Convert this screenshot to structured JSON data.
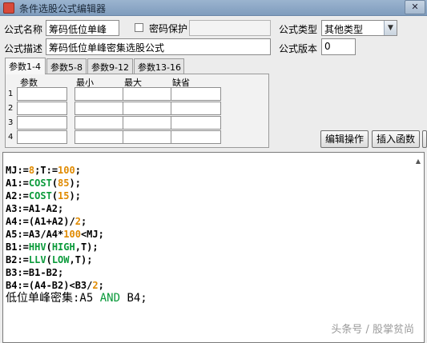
{
  "window": {
    "title": "条件选股公式编辑器",
    "close": "✕"
  },
  "form": {
    "name_label": "公式名称",
    "name_value": "筹码低位单峰",
    "password_label": "密码保护",
    "password_value": "",
    "type_label": "公式类型",
    "type_value": "其他类型",
    "desc_label": "公式描述",
    "desc_value": "筹码低位单峰密集选股公式",
    "version_label": "公式版本",
    "version_value": "0"
  },
  "tabs": [
    "参数1-4",
    "参数5-8",
    "参数9-12",
    "参数13-16"
  ],
  "params": {
    "headers": [
      "参数",
      "最小",
      "最大",
      "缺省"
    ],
    "rows": [
      "1",
      "2",
      "3",
      "4"
    ]
  },
  "buttons": {
    "edit": "编辑操作",
    "insert": "插入函数"
  },
  "code": {
    "lines": [
      [
        {
          "t": "MJ:=",
          "c": ""
        },
        {
          "t": "8",
          "c": "num"
        },
        {
          "t": ";T:=",
          "c": ""
        },
        {
          "t": "100",
          "c": "num"
        },
        {
          "t": ";",
          "c": ""
        }
      ],
      [
        {
          "t": "A1:=",
          "c": ""
        },
        {
          "t": "COST",
          "c": "fn"
        },
        {
          "t": "(",
          "c": ""
        },
        {
          "t": "85",
          "c": "num"
        },
        {
          "t": ");",
          "c": ""
        }
      ],
      [
        {
          "t": "A2:=",
          "c": ""
        },
        {
          "t": "COST",
          "c": "fn"
        },
        {
          "t": "(",
          "c": ""
        },
        {
          "t": "15",
          "c": "num"
        },
        {
          "t": ");",
          "c": ""
        }
      ],
      [
        {
          "t": "A3:=A1-A2;",
          "c": ""
        }
      ],
      [
        {
          "t": "A4:=(A1+A2)/",
          "c": ""
        },
        {
          "t": "2",
          "c": "num"
        },
        {
          "t": ";",
          "c": ""
        }
      ],
      [
        {
          "t": "A5:=A3/A4*",
          "c": ""
        },
        {
          "t": "100",
          "c": "num"
        },
        {
          "t": "<MJ;",
          "c": ""
        }
      ],
      [
        {
          "t": "B1:=",
          "c": ""
        },
        {
          "t": "HHV",
          "c": "fn"
        },
        {
          "t": "(",
          "c": ""
        },
        {
          "t": "HIGH",
          "c": "fn"
        },
        {
          "t": ",T);",
          "c": ""
        }
      ],
      [
        {
          "t": "B2:=",
          "c": ""
        },
        {
          "t": "LLV",
          "c": "fn"
        },
        {
          "t": "(",
          "c": ""
        },
        {
          "t": "LOW",
          "c": "fn"
        },
        {
          "t": ",T);",
          "c": ""
        }
      ],
      [
        {
          "t": "B3:=B1-B2;",
          "c": ""
        }
      ],
      [
        {
          "t": "B4:=(A4-B2)<B3/",
          "c": ""
        },
        {
          "t": "2",
          "c": "num"
        },
        {
          "t": ";",
          "c": ""
        }
      ],
      [
        {
          "t": "低位单峰密集:A5 ",
          "c": ""
        },
        {
          "t": "AND",
          "c": "kw"
        },
        {
          "t": " B4;",
          "c": ""
        }
      ]
    ]
  },
  "watermark": "头条号 / 股掌贫尚"
}
